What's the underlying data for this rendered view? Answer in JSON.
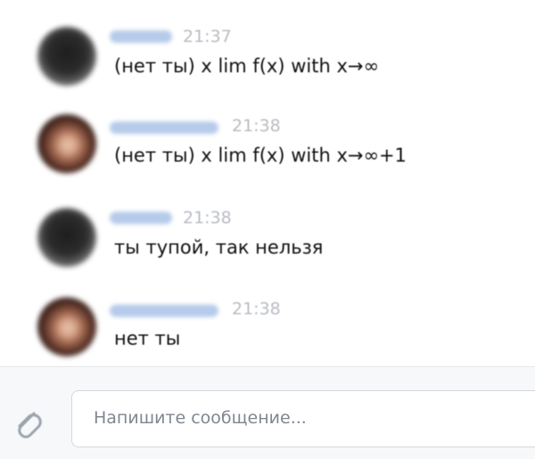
{
  "messages": [
    {
      "avatar": "blurred-dark-avatar",
      "time": "21:37",
      "text": "(нет ты) x lim f(x) with x→∞"
    },
    {
      "avatar": "blurred-photo-avatar",
      "time": "21:38",
      "text": "(нет ты) x lim f(x) with x→∞+1"
    },
    {
      "avatar": "blurred-dark-avatar",
      "time": "21:38",
      "text": "ты тупой, так нельзя"
    },
    {
      "avatar": "blurred-photo-avatar",
      "time": "21:38",
      "text": "нет ты"
    }
  ],
  "composer": {
    "placeholder": "Напишите сообщение..."
  },
  "icons": {
    "attach": "paperclip-icon"
  },
  "colors": {
    "name_blur": "#a9c2e6",
    "timestamp": "#b8bcc2",
    "text": "#111111",
    "placeholder": "#7f8790",
    "attach_icon": "#9aa3ad"
  }
}
